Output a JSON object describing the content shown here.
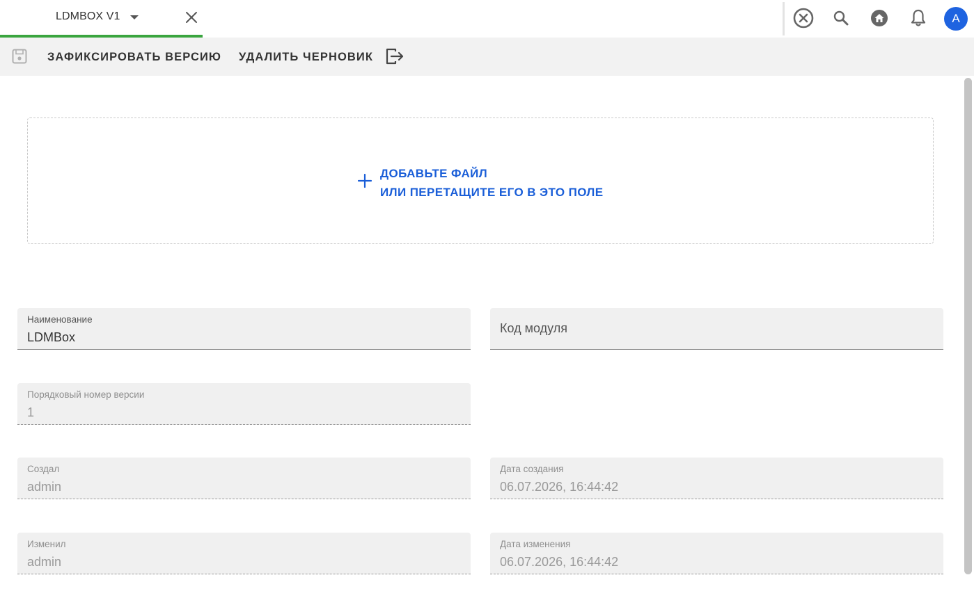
{
  "tab": {
    "label": "LDMBOX V1"
  },
  "toolbar": {
    "commit_label": "Зафиксировать версию",
    "delete_draft_label": "Удалить черновик"
  },
  "dropzone": {
    "line1": "Добавьте файл",
    "line2": "или перетащите его в это поле"
  },
  "user": {
    "avatar_letter": "A"
  },
  "fields": {
    "name": {
      "label": "Наименование",
      "value": "LDMBox"
    },
    "module_code": {
      "placeholder": "Код модуля"
    },
    "version_number": {
      "label": "Порядковый номер версии",
      "value": "1"
    },
    "created_by": {
      "label": "Создал",
      "value": "admin"
    },
    "created_at": {
      "label": "Дата создания",
      "value": "06.07.2026, 16:44:42"
    },
    "modified_by": {
      "label": "Изменил",
      "value": "admin"
    },
    "modified_at": {
      "label": "Дата изменения",
      "value": "06.07.2026, 16:44:42"
    }
  },
  "colors": {
    "accent_blue": "#1a5ed8",
    "tab_underline_green": "#3aa53f",
    "avatar_blue": "#1e63e0"
  },
  "icons": [
    "save-icon",
    "exit-icon",
    "close-circle-icon",
    "search-icon",
    "home-icon",
    "bell-icon",
    "plus-icon",
    "close-icon",
    "caret-down-icon"
  ]
}
